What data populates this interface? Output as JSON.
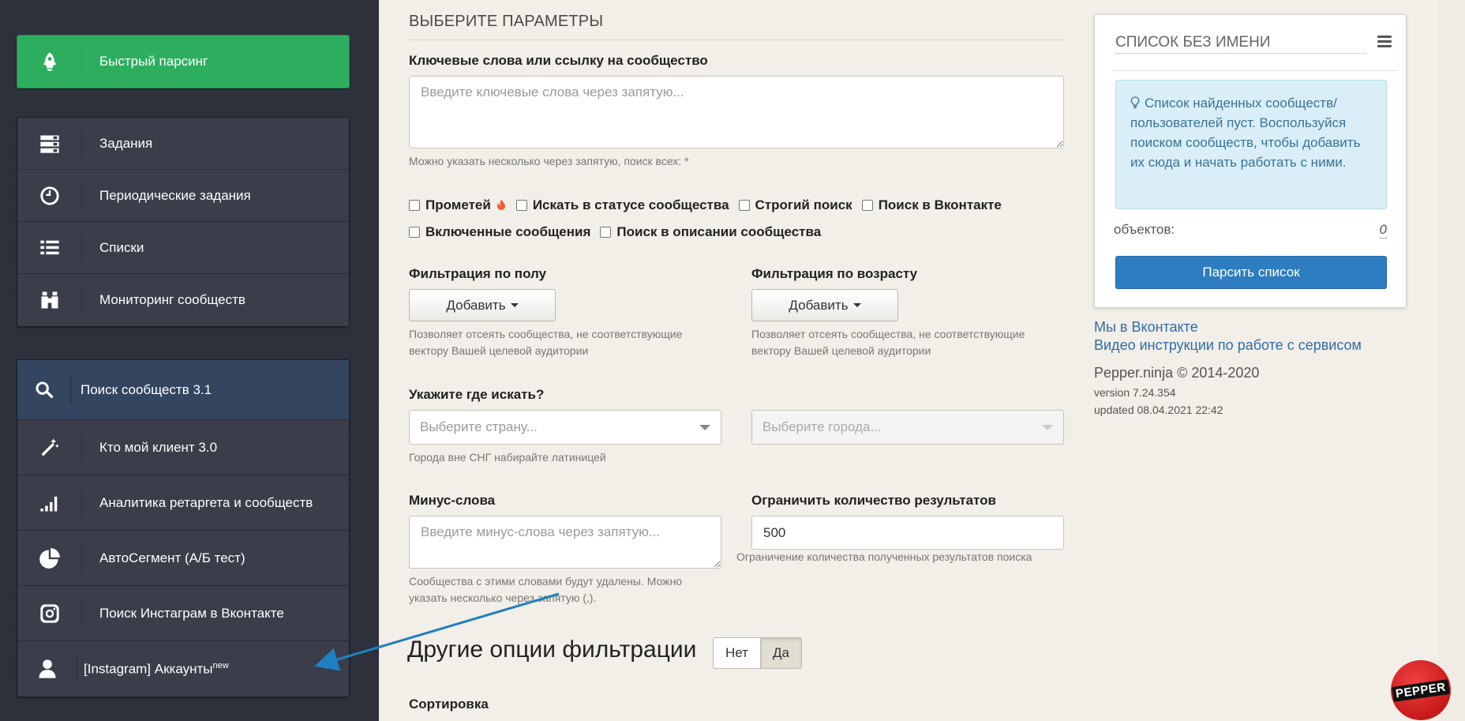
{
  "sidebar": {
    "fast_parse": "Быстрый парсинг",
    "tasks_group": [
      {
        "label": "Задания",
        "icon": "tasks-icon"
      },
      {
        "label": "Периодические задания",
        "icon": "clock-icon"
      },
      {
        "label": "Списки",
        "icon": "list-icon"
      },
      {
        "label": "Мониторинг сообществ",
        "icon": "binoculars-icon"
      }
    ],
    "tools_group": [
      {
        "label": "Поиск сообществ 3.1",
        "icon": "search-icon"
      },
      {
        "label": "Кто мой клиент 3.0",
        "icon": "magic-wand-icon"
      },
      {
        "label": "Аналитика ретаргета и сообществ",
        "icon": "signal-bars-icon"
      },
      {
        "label": "АвтоСегмент (А/Б тест)",
        "icon": "pie-chart-icon"
      },
      {
        "label": "Поиск Инстаграм в Вконтакте",
        "icon": "instagram-icon"
      },
      {
        "label": "[Instagram] Аккаунты",
        "sup": "new",
        "icon": "user-icon"
      }
    ]
  },
  "form": {
    "section_title": "ВЫБЕРИТЕ ПАРАМЕТРЫ",
    "keywords": {
      "label": "Ключевые слова или ссылку на сообщество",
      "placeholder": "Введите ключевые слова через запятую...",
      "help": "Можно указать несколько через запятую, поиск всех: *"
    },
    "checkboxes": {
      "prometheus": "Прометей",
      "status": "Искать в статусе сообщества",
      "strict": "Строгий поиск",
      "vk": "Поиск в Вконтакте",
      "messages": "Включенные сообщения",
      "description": "Поиск в описании сообщества"
    },
    "gender": {
      "label": "Фильтрация по полу",
      "button": "Добавить",
      "help": "Позволяет отсеять сообщества, не соответствующие вектору Вашей целевой аудитории"
    },
    "age": {
      "label": "Фильтрация по возрасту",
      "button": "Добавить",
      "help": "Позволяет отсеять сообщества, не соответствующие вектору Вашей целевой аудитории"
    },
    "where": {
      "label": "Укажите где искать?",
      "country_placeholder": "Выберите страну...",
      "city_placeholder": "Выберите города...",
      "help": "Города вне СНГ набирайте латиницей"
    },
    "minus": {
      "label": "Минус-слова",
      "placeholder": "Введите минус-слова через запятую...",
      "help": "Сообщества с этими словами будут удалены. Можно указать несколько через запятую (,)."
    },
    "limit": {
      "label": "Ограничить количество результатов",
      "value": "500",
      "help": "Ограничение количества полученных результатов поиска"
    },
    "other_options": {
      "title": "Другие опции фильтрации",
      "no": "Нет",
      "yes": "Да"
    },
    "sort_label": "Сортировка"
  },
  "panel": {
    "title": "СПИСОК БЕЗ ИМЕНИ",
    "alert": "Список найденных сообществ/пользователей пуст. Воспользуйся поиском сообществ, чтобы добавить их сюда и начать работать с ними.",
    "objects_label": "объектов:",
    "objects_count": "0",
    "parse_button": "Парсить список"
  },
  "links": {
    "vk": "Мы в Вконтакте",
    "video": "Видео инструкции по работе с сервисом"
  },
  "footer": {
    "copyright": "Pepper.ninja © 2014-2020",
    "version": "version 7.24.354",
    "updated": "updated 08.04.2021 22:42"
  },
  "badge": "PEPPER",
  "colors": {
    "sidebar_bg": "#2d303b",
    "fast_parse_green": "#2dae5e",
    "active_item": "#33455f",
    "primary_button": "#2e7dc1",
    "alert_bg": "#d9eef6",
    "arrow": "#1f7fc0"
  }
}
